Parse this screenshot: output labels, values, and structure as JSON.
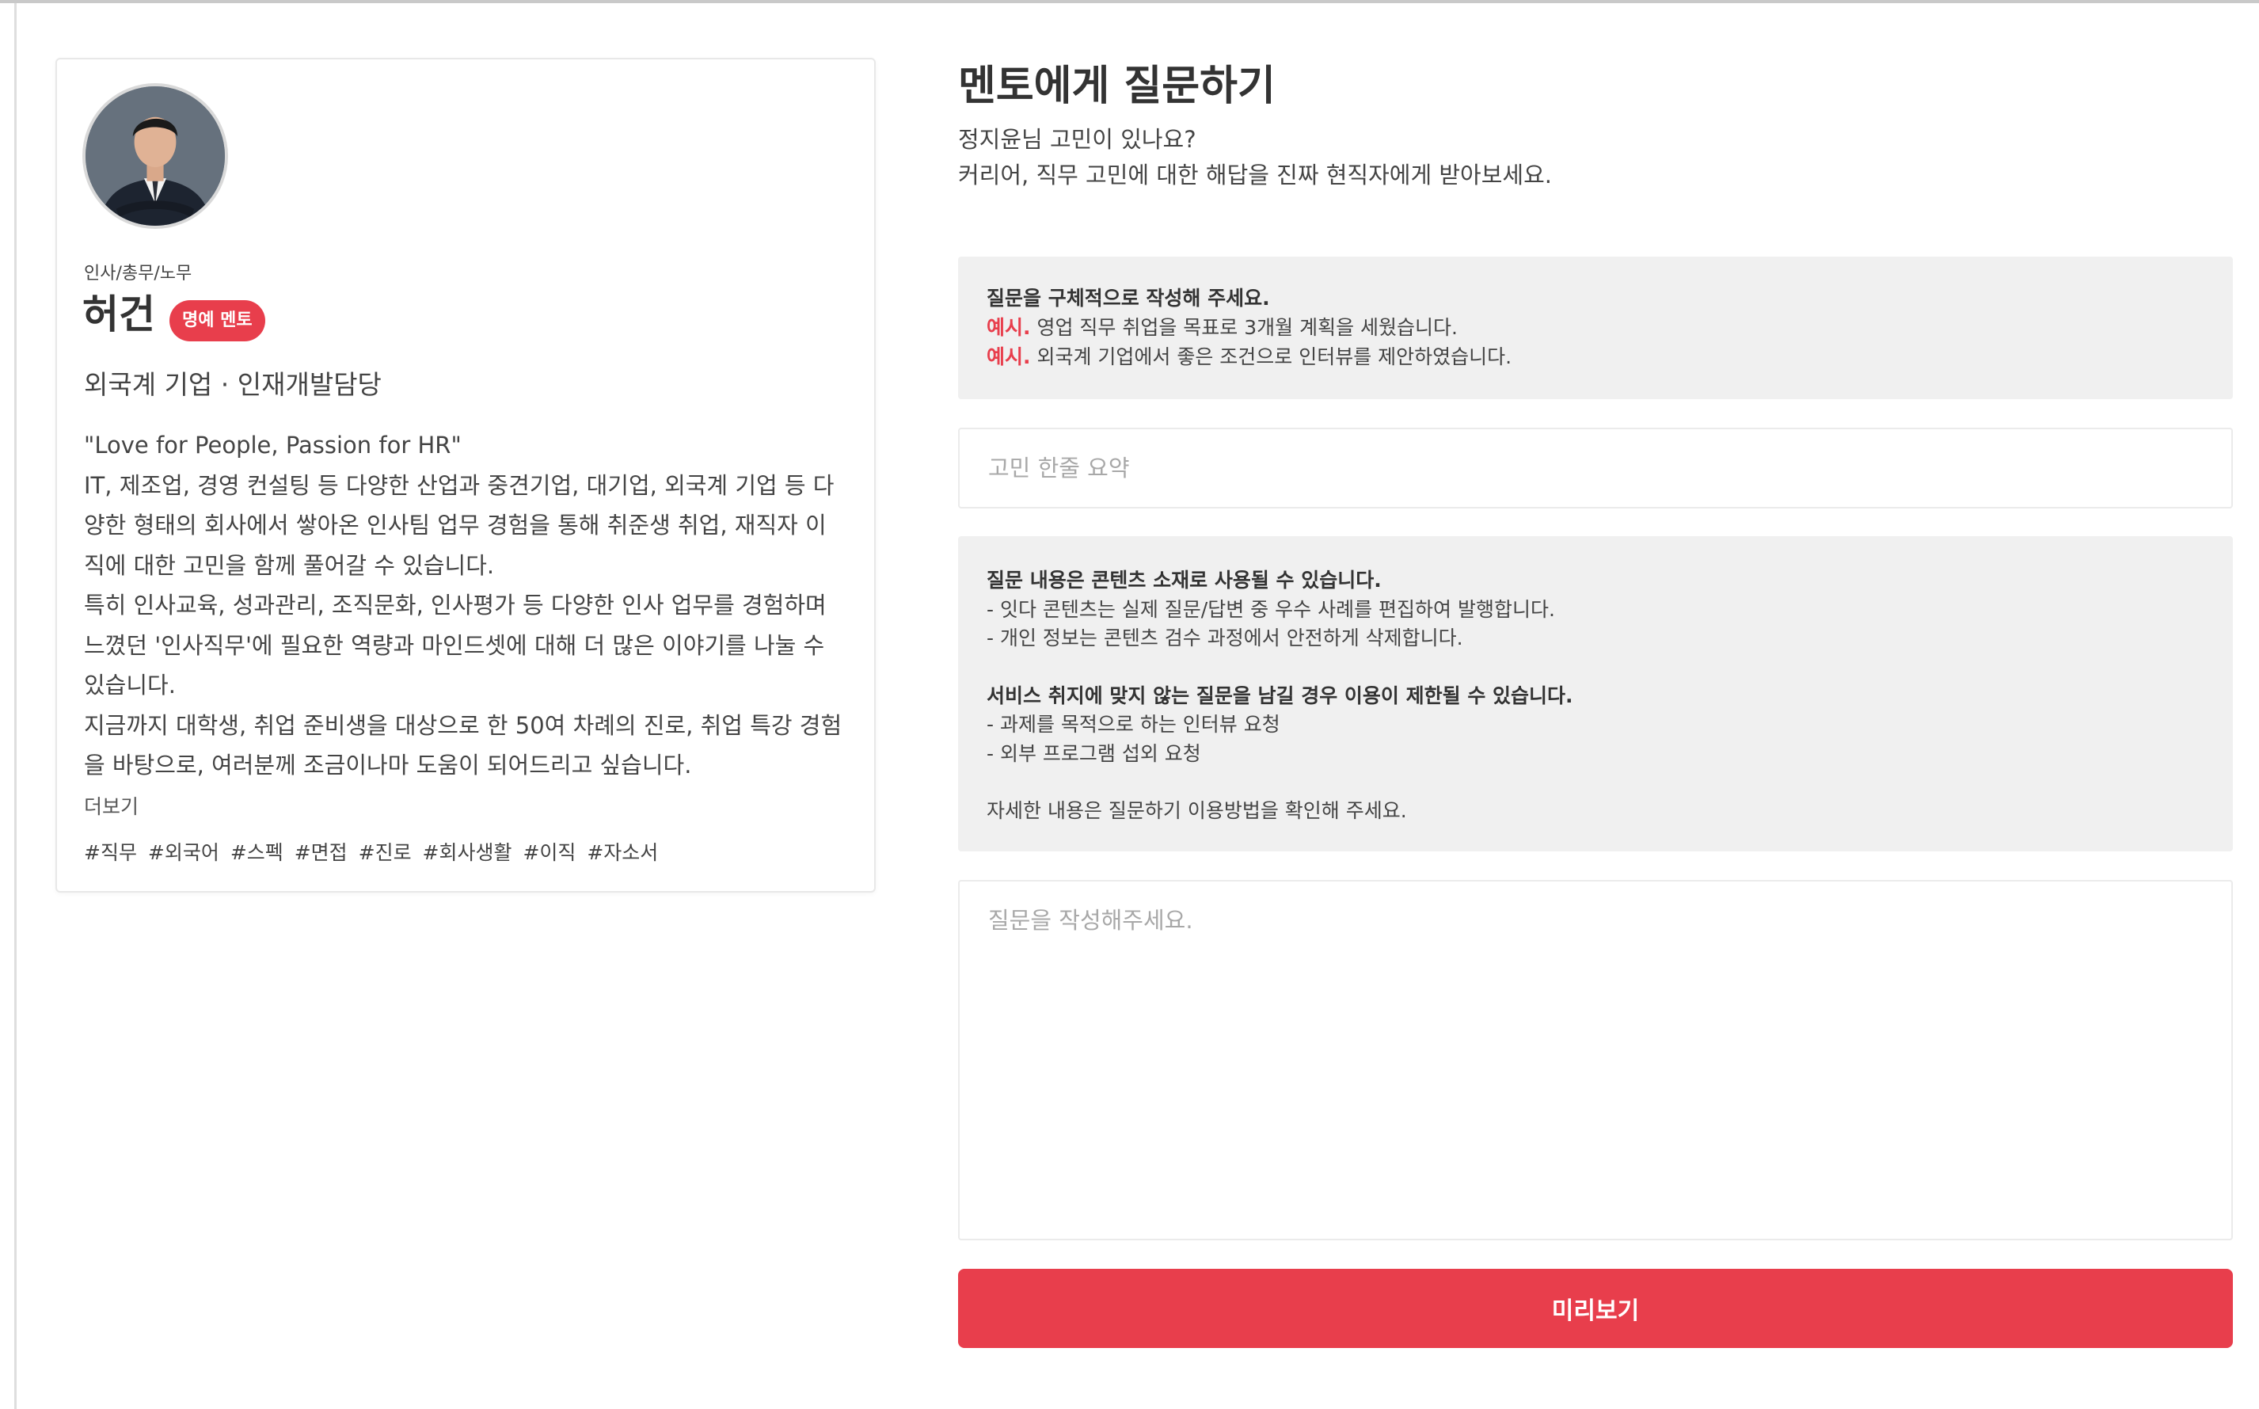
{
  "profile": {
    "job_category": "인사/총무/노무",
    "name": "허건",
    "badge": "명예 멘토",
    "company_position": "외국계 기업 · 인재개발담당",
    "bio_lines": [
      "\"Love for People, Passion for HR\"",
      "IT, 제조업, 경영 컨설팅 등 다양한 산업과 중견기업, 대기업, 외국계 기업 등 다",
      "양한 형태의 회사에서 쌓아온 인사팀 업무 경험을 통해 취준생 취업, 재직자 이",
      "직에 대한 고민을 함께 풀어갈 수 있습니다.",
      "특히 인사교육, 성과관리, 조직문화, 인사평가 등 다양한 인사 업무를 경험하며",
      "느꼈던 '인사직무'에 필요한 역량과 마인드셋에 대해 더 많은 이야기를 나눌 수",
      "있습니다.",
      "지금까지 대학생, 취업 준비생을 대상으로 한 50여 차례의 진로, 취업 특강 경험",
      "을 바탕으로, 여러분께 조금이나마 도움이 되어드리고 싶습니다."
    ],
    "more_label": "더보기",
    "tags": [
      "#직무",
      "#외국어",
      "#스펙",
      "#면접",
      "#진로",
      "#회사생활",
      "#이직",
      "#자소서"
    ]
  },
  "form": {
    "title": "멘토에게 질문하기",
    "subtitle_line1": "정지윤님 고민이 있나요?",
    "subtitle_line2": "커리어, 직무 고민에 대한 해답을 진짜 현직자에게 받아보세요.",
    "guide": {
      "heading": "질문을 구체적으로 작성해 주세요.",
      "example_prefix": "예시.",
      "example1": " 영업 직무 취업을 목표로 3개월 계획을 세웠습니다.",
      "example2": " 외국계 기업에서 좋은 조건으로 인터뷰를 제안하였습니다."
    },
    "summary_placeholder": "고민 한줄 요약",
    "notice": {
      "heading1": "질문 내용은 콘텐츠 소재로 사용될 수 있습니다.",
      "line1": "- 잇다 콘텐츠는 실제 질문/답변 중 우수 사례를 편집하여 발행합니다.",
      "line2": "- 개인 정보는 콘텐츠 검수 과정에서 안전하게 삭제합니다.",
      "heading2": "서비스 취지에 맞지 않는 질문을 남길 경우 이용이 제한될 수 있습니다.",
      "line3": "- 과제를 목적으로 하는 인터뷰 요청",
      "line4": "- 외부 프로그램 섭외 요청",
      "footer": "자세한 내용은 질문하기 이용방법을 확인해 주세요."
    },
    "question_placeholder": "질문을 작성해주세요.",
    "preview_label": "미리보기"
  },
  "colors": {
    "accent": "#e83e4c",
    "panel_bg": "#f0f0f0"
  }
}
